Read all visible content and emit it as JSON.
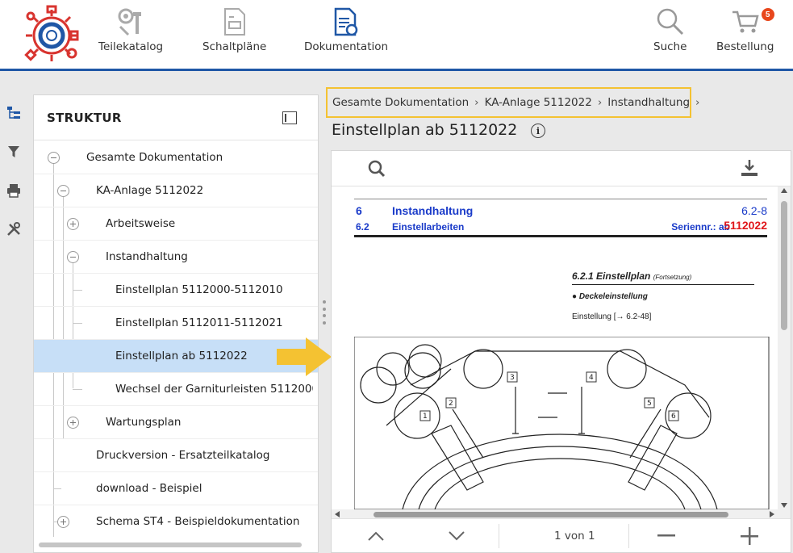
{
  "header": {
    "nav": [
      {
        "label": "Teilekatalog"
      },
      {
        "label": "Schaltpläne"
      },
      {
        "label": "Dokumentation"
      }
    ],
    "search_label": "Suche",
    "order_label": "Bestellung",
    "order_count": "5"
  },
  "structure": {
    "title": "STRUKTUR",
    "items": [
      {
        "label": "Gesamte Dokumentation"
      },
      {
        "label": "KA-Anlage 5112022"
      },
      {
        "label": "Arbeitsweise"
      },
      {
        "label": "Instandhaltung"
      },
      {
        "label": "Einstellplan 5112000-5112010"
      },
      {
        "label": "Einstellplan 5112011-5112021"
      },
      {
        "label": "Einstellplan ab 5112022"
      },
      {
        "label": "Wechsel der Garniturleisten 5112000-"
      },
      {
        "label": "Wartungsplan"
      },
      {
        "label": "Druckversion - Ersatzteilkatalog"
      },
      {
        "label": "download - Beispiel"
      },
      {
        "label": "Schema ST4 - Beispieldokumentation"
      }
    ]
  },
  "breadcrumb": [
    "Gesamte Dokumentation",
    "KA-Anlage 5112022",
    "Instandhaltung"
  ],
  "document": {
    "title": "Einstellplan ab 5112022",
    "pager": "1 von 1",
    "page": {
      "chapter_num": "6",
      "chapter_title": "Instandhaltung",
      "chapter_ref": "6.2-8",
      "section_num": "6.2",
      "section_title": "Einstellarbeiten",
      "serial_label": "Seriennr.: ab",
      "serial_number": "5112022",
      "subsection": "6.2.1   Einstellplan",
      "subsection_note": "(Fortsetzung)",
      "bullet": "●  Deckeleinstellung",
      "adjust_ref": "Einstellung [→ 6.2-48]",
      "callouts": [
        "1",
        "2",
        "3",
        "4",
        "5",
        "6"
      ]
    }
  },
  "colors": {
    "brand_blue": "#1f57a6",
    "selection": "#c7dff7",
    "highlight": "#f4c232",
    "pdf_blue": "#1a3bc9",
    "pdf_red": "#e0171b",
    "badge": "#e8471c"
  }
}
